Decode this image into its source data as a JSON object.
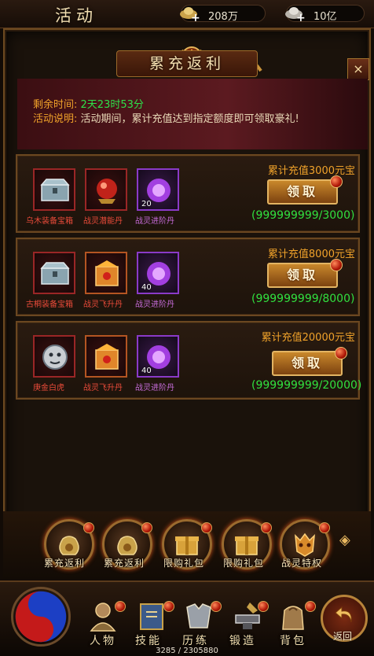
{
  "header": {
    "title": "活动"
  },
  "currency": [
    {
      "icon": "gold-ingot-icon",
      "value": "208万"
    },
    {
      "icon": "silver-ingot-icon",
      "value": "10亿"
    }
  ],
  "panel": {
    "title": "累充返利",
    "remaining_label": "剩余时间:",
    "remaining_value": "2天23时53分",
    "desc_label": "活动说明:",
    "desc_value": "活动期间，累计充值达到指定额度即可领取豪礼!"
  },
  "rewards": [
    {
      "requirement": "累计充值3000元宝",
      "claim_label": "领取",
      "progress": "(999999999/3000)",
      "items": [
        {
          "name": "乌木装备宝箱",
          "count": "",
          "icon": "chest-icon"
        },
        {
          "name": "战灵潜能丹",
          "count": "",
          "icon": "red-orb-icon"
        },
        {
          "name": "战灵进阶丹",
          "count": "20",
          "icon": "purple-orb-icon"
        }
      ]
    },
    {
      "requirement": "累计充值8000元宝",
      "claim_label": "领取",
      "progress": "(999999999/8000)",
      "items": [
        {
          "name": "古桐装备宝箱",
          "count": "",
          "icon": "chest-icon"
        },
        {
          "name": "战灵飞升丹",
          "count": "",
          "icon": "gold-box-icon"
        },
        {
          "name": "战灵进阶丹",
          "count": "40",
          "icon": "purple-orb-icon"
        }
      ]
    },
    {
      "requirement": "累计充值20000元宝",
      "claim_label": "领取",
      "progress": "(999999999/20000)",
      "items": [
        {
          "name": "庚金白虎",
          "count": "",
          "icon": "tiger-icon"
        },
        {
          "name": "战灵飞升丹",
          "count": "",
          "icon": "gold-box-icon"
        },
        {
          "name": "战灵进阶丹",
          "count": "40",
          "icon": "purple-orb-icon"
        }
      ]
    }
  ],
  "activity_tabs": [
    {
      "label": "累充返利",
      "icon": "money-bag-icon"
    },
    {
      "label": "累充返利",
      "icon": "money-bag-icon"
    },
    {
      "label": "限购礼包",
      "icon": "gift-box-icon"
    },
    {
      "label": "限购礼包",
      "icon": "gift-box-icon"
    },
    {
      "label": "战灵特权",
      "icon": "demon-mask-icon"
    }
  ],
  "nav": [
    {
      "label": "人物",
      "icon": "character-icon"
    },
    {
      "label": "技能",
      "icon": "skill-book-icon"
    },
    {
      "label": "历练",
      "icon": "armor-icon"
    },
    {
      "label": "锻造",
      "icon": "anvil-icon"
    },
    {
      "label": "背包",
      "icon": "bag-icon"
    }
  ],
  "return_label": "返回",
  "exp_text": "3285 / 2305880",
  "colors": {
    "accent_orange": "#f0a22a",
    "progress_green": "#31e03f",
    "timer_green": "#2ee04a"
  }
}
